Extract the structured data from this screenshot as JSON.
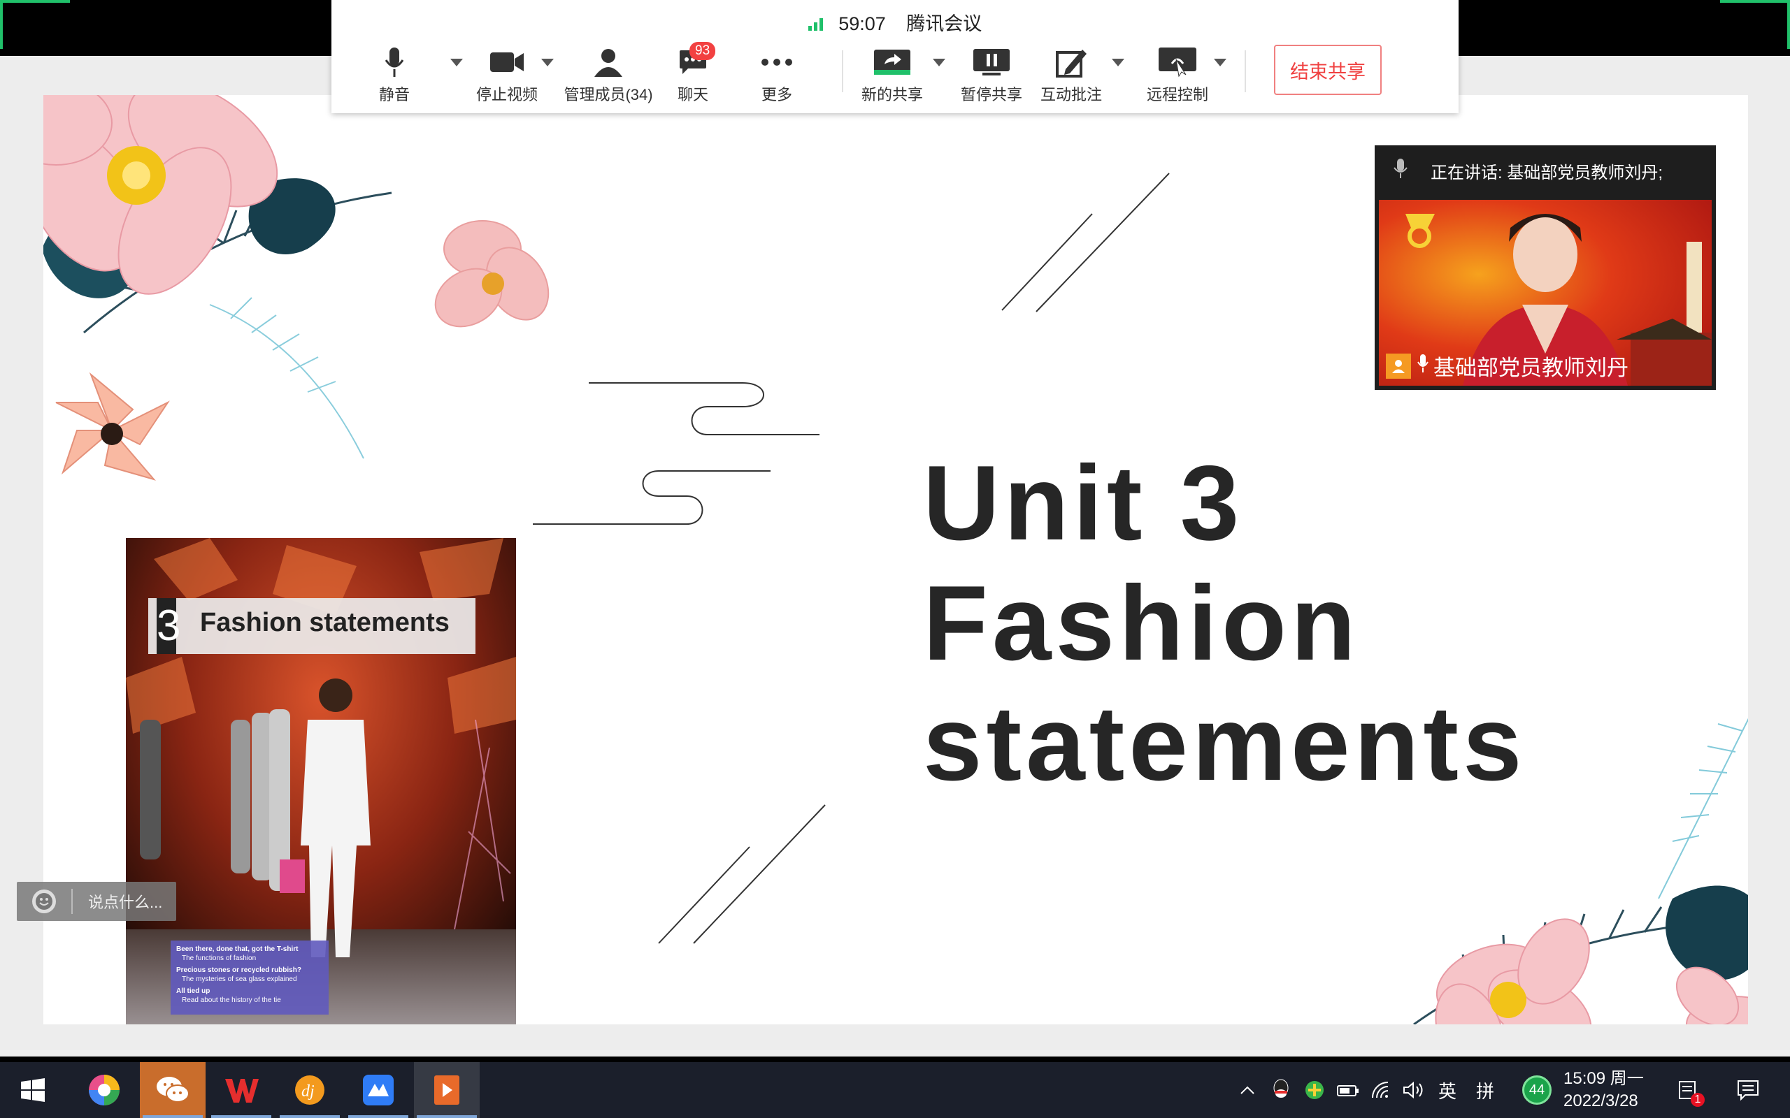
{
  "meeting": {
    "timer": "59:07",
    "app_name": "腾讯会议",
    "toolbar": [
      {
        "id": "mute",
        "label": "静音",
        "icon": "microphone-icon"
      },
      {
        "id": "stop-video",
        "label": "停止视频",
        "icon": "video-camera-icon"
      },
      {
        "id": "members",
        "label": "管理成员(34)",
        "icon": "person-icon"
      },
      {
        "id": "chat",
        "label": "聊天",
        "icon": "chat-bubble-icon",
        "badge": "93"
      },
      {
        "id": "more",
        "label": "更多",
        "icon": "more-dots-icon"
      },
      {
        "id": "new-share",
        "label": "新的共享",
        "icon": "share-screen-icon"
      },
      {
        "id": "pause-share",
        "label": "暂停共享",
        "icon": "pause-icon"
      },
      {
        "id": "annotate",
        "label": "互动批注",
        "icon": "annotate-icon"
      },
      {
        "id": "remote",
        "label": "远程控制",
        "icon": "remote-control-icon"
      }
    ],
    "end_share_label": "结束共享",
    "accent_color": "#20c06a",
    "end_color": "#f04040"
  },
  "slide": {
    "title_lines": [
      "Unit 3",
      "Fashion",
      "statements"
    ],
    "book": {
      "unit_number": "3",
      "unit_title": "Fashion statements",
      "contents": [
        {
          "heading": "Been there, done that, got the T-shirt",
          "sub": "The functions of fashion"
        },
        {
          "heading": "Precious stones or recycled rubbish?",
          "sub": "The mysteries of sea glass explained"
        },
        {
          "heading": "All tied up",
          "sub": "Read about the history of the tie"
        }
      ]
    }
  },
  "video_tile": {
    "speaking_text": "正在讲话: 基础部党员教师刘丹;",
    "participant_name": "基础部党员教师刘丹"
  },
  "chat_input": {
    "placeholder": "说点什么..."
  },
  "taskbar": {
    "apps": [
      "chrome-like-icon",
      "wechat-icon",
      "wps-icon",
      "dj-app-icon",
      "tencent-meeting-icon",
      "slides-player-icon"
    ],
    "tray": {
      "ime_lang": "英",
      "ime_mode": "拼",
      "badge_count": "44",
      "time": "15:09",
      "weekday": "周一",
      "date": "2022/3/28",
      "notification_count": "1"
    }
  }
}
